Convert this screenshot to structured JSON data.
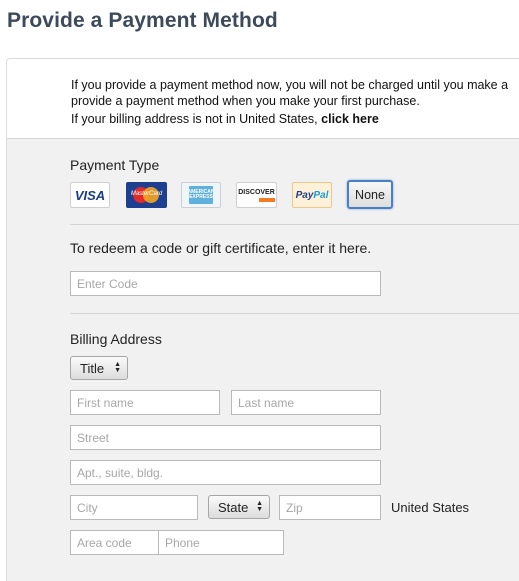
{
  "page": {
    "title": "Provide a Payment Method"
  },
  "notice": {
    "line1": "If you provide a payment method now, you will not be charged until you make a",
    "line2": "provide a payment method when you make your first purchase.",
    "line3_prefix": "If your billing address is not in United States, ",
    "click_here": "click here"
  },
  "payment_type": {
    "label": "Payment Type",
    "cards": {
      "visa": "VISA",
      "mastercard": "MasterCard",
      "amex": "AMERICAN EXPRESS",
      "discover": "DISCOVER",
      "paypal_pay": "Pay",
      "paypal_pal": "Pal",
      "none": "None"
    },
    "selected": "None"
  },
  "redeem": {
    "label": "To redeem a code or gift certificate, enter it here.",
    "placeholder": "Enter Code",
    "value": ""
  },
  "billing": {
    "label": "Billing Address",
    "title_select": "Title",
    "first_name_placeholder": "First name",
    "last_name_placeholder": "Last name",
    "street_placeholder": "Street",
    "apt_placeholder": "Apt., suite, bldg.",
    "city_placeholder": "City",
    "state_select": "State",
    "zip_placeholder": "Zip",
    "country": "United States",
    "area_code_placeholder": "Area code",
    "phone_placeholder": "Phone"
  },
  "colors": {
    "title": "#3c4a5c",
    "panel_bg": "#f1f1f1",
    "selected_border": "#4b7fc4"
  }
}
